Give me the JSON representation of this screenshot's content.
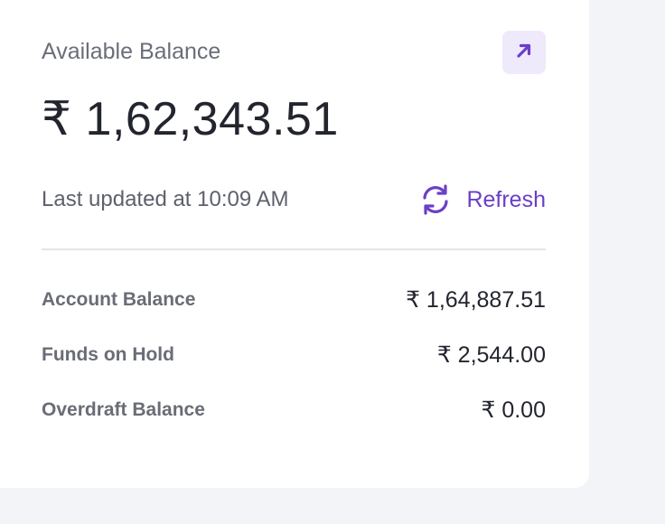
{
  "card": {
    "title": "Available Balance",
    "amount": "₹ 1,62,343.51",
    "last_updated": "Last updated at 10:09 AM",
    "refresh_label": "Refresh",
    "expand_icon": "arrow-up-right-icon",
    "refresh_icon": "refresh-icon"
  },
  "breakdown": [
    {
      "label": "Account Balance",
      "value": "₹ 1,64,887.51"
    },
    {
      "label": "Funds on Hold",
      "value": "₹ 2,544.00"
    },
    {
      "label": "Overdraft Balance",
      "value": "₹ 0.00"
    }
  ],
  "colors": {
    "accent": "#6a3fc7",
    "accent_bg": "#eee9fb",
    "text_primary": "#23252e",
    "text_secondary": "#6b6e78",
    "page_bg": "#f3f4f8",
    "card_bg": "#ffffff"
  }
}
